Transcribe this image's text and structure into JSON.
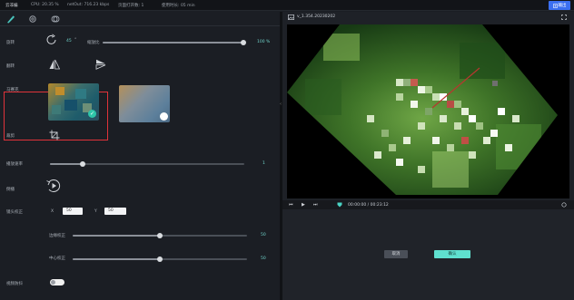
{
  "topbar": {
    "app_name": "云非编",
    "cpu": "CPU: 20.35 %",
    "netout": "netOut: 716.23 kbps",
    "pages": "页面打开数: 1",
    "duration": "使用时长: 05 min",
    "export_label": "输出"
  },
  "toolbar": {
    "tools": [
      "brush-icon",
      "gear-icon",
      "layers-icon"
    ]
  },
  "left_panel": {
    "rotate": {
      "label": "旋转",
      "angle": "45",
      "degree": "°"
    },
    "scale": {
      "label": "缩放比",
      "value": "100 %",
      "fraction": 1.0
    },
    "flip": {
      "label": "翻转"
    },
    "mosaic": {
      "label": "马赛克"
    },
    "crop": {
      "label": "裁剪"
    },
    "speed": {
      "label": "播放速率",
      "value": "1",
      "fraction": 0.2
    },
    "reverse": {
      "label": "倒播"
    },
    "lens": {
      "label": "镜头校正",
      "x_label": "X",
      "x_value": "50",
      "y_label": "Y",
      "y_value": "50",
      "edge_label": "边缘校正",
      "edge_value": "50",
      "edge_fraction": 0.5,
      "center_label": "中心校正",
      "center_value": "50",
      "center_fraction": 0.5
    },
    "stabilize": {
      "label": "视频防抖",
      "on": false
    }
  },
  "right_panel": {
    "filename": "v_1.354.20230202",
    "time": "00:00:00 / 00:23:12",
    "cancel_label": "取消",
    "ok_label": "确认",
    "colors": {
      "accent": "#5fe0cf",
      "export": "#3b6ff1",
      "highlight": "#e0333a"
    }
  }
}
